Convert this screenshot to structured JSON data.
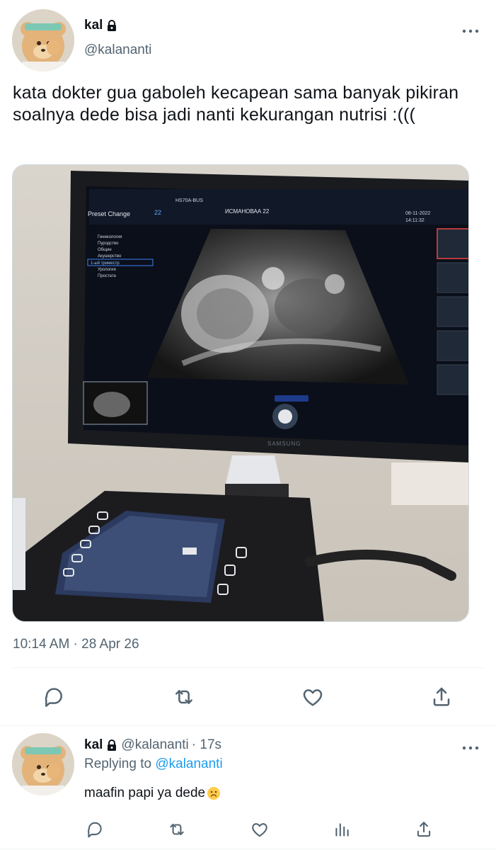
{
  "tweet": {
    "author_name": "kal",
    "author_handle": "@kalananti",
    "text": "kata dokter gua gaboleh kecapean sama banyak pikiran soalnya dede bisa jadi nanti kekurangan nutrisi :(((",
    "timestamp": "10:14 AM · 28 Apr 26",
    "media": {
      "description_icon": "ultrasound-photo",
      "monitor_brand": "SAMSUNG",
      "screen_header": "HS70A-BUS",
      "patient_label": "ИСМАНОВАА 22",
      "preset_label": "Preset Change",
      "preset_items": [
        "Гинекология",
        "Пуродство",
        "Общие",
        "Акушерство",
        "1-ый триместр",
        "Урология",
        "Простата"
      ],
      "probe_label": "22",
      "date_label": "08-11-2022",
      "time_label": "14:11:32"
    }
  },
  "reply": {
    "author_name": "kal",
    "author_handle": "@kalananti",
    "age": "· 17s",
    "replying_prefix": "Replying to",
    "replying_handle": "@kalananti",
    "text": "maafin papi ya dede",
    "emoji": "slightly-frowning-face"
  },
  "icons": {
    "more": "more-icon",
    "lock": "lock-icon",
    "reply": "reply-icon",
    "retweet": "retweet-icon",
    "like": "like-icon",
    "share": "share-icon",
    "views": "views-icon"
  },
  "colors": {
    "primary_text": "#0f1419",
    "secondary_text": "#536471",
    "link": "#1d9bf0",
    "divider": "#eff3f4"
  }
}
